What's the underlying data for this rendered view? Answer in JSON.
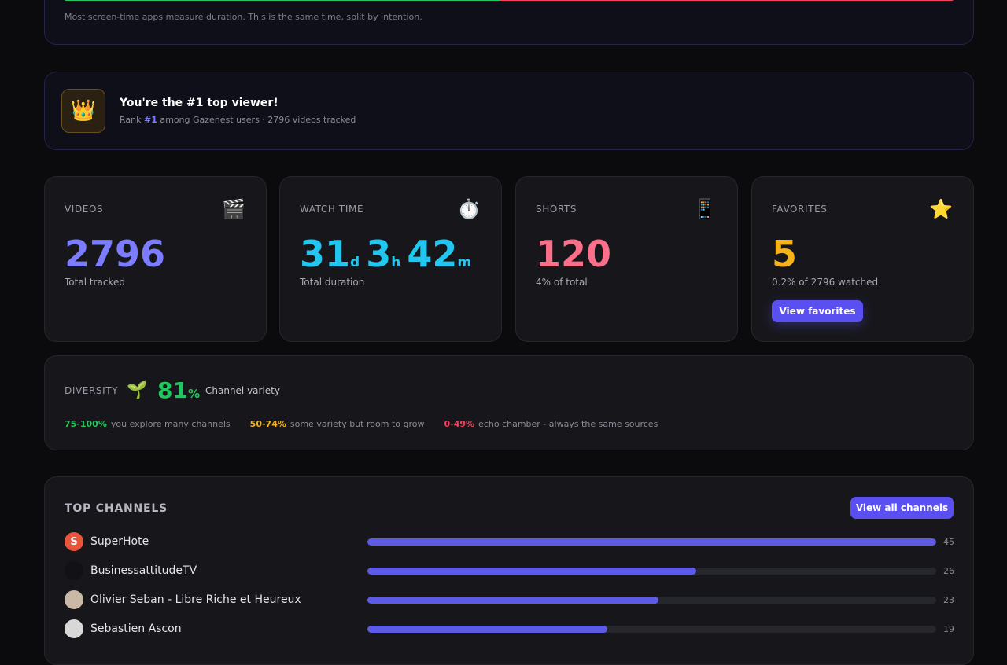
{
  "intention": {
    "split": [
      0.49,
      0.51
    ],
    "colors": [
      "#22c55e",
      "#f43f5e"
    ],
    "note": "Most screen-time apps measure duration. This is the same time, split by intention."
  },
  "rank": {
    "icon": "crown-icon",
    "title": "You're the #1 top viewer!",
    "rank_prefix": "Rank",
    "rank_value": "#1",
    "rank_suffix": "among Gazenest users · 2796 videos tracked"
  },
  "stats": {
    "videos": {
      "label": "VIDEOS",
      "icon": "clapper-icon",
      "value": "2796",
      "sub": "Total tracked"
    },
    "watch_time": {
      "label": "WATCH TIME",
      "icon": "stopwatch-icon",
      "days": "31",
      "days_unit": "d",
      "hours": "3",
      "hours_unit": "h",
      "minutes": "42",
      "minutes_unit": "m",
      "sub": "Total duration"
    },
    "shorts": {
      "label": "SHORTS",
      "icon": "phone-icon",
      "value": "120",
      "sub": "4% of total"
    },
    "favorites": {
      "label": "FAVORITES",
      "icon": "star-icon",
      "value": "5",
      "sub": "0.2% of 2796 watched",
      "button": "View favorites"
    }
  },
  "diversity": {
    "label": "DIVERSITY",
    "icon": "seedling-icon",
    "value": "81",
    "unit": "%",
    "caption": "Channel variety",
    "legend": [
      {
        "range": "75-100%",
        "text": "you explore many channels"
      },
      {
        "range": "50-74%",
        "text": "some variety but room to grow"
      },
      {
        "range": "0-49%",
        "text": "echo chamber - always the same sources"
      }
    ]
  },
  "channels": {
    "title": "TOP CHANNELS",
    "button": "View all channels",
    "max": 45,
    "items": [
      {
        "name": "SuperHote",
        "count": 45,
        "avatar_letter": "S",
        "avatar_color": "#e8553a"
      },
      {
        "name": "BusinessattitudeTV",
        "count": 26,
        "avatar_letter": "",
        "avatar_color": "#111116"
      },
      {
        "name": "Olivier Seban - Libre Riche et Heureux",
        "count": 23,
        "avatar_letter": "",
        "avatar_color": "#c9b9a6"
      },
      {
        "name": "Sebastien Ascon",
        "count": 19,
        "avatar_letter": "",
        "avatar_color": "#d8d8d8"
      }
    ]
  }
}
